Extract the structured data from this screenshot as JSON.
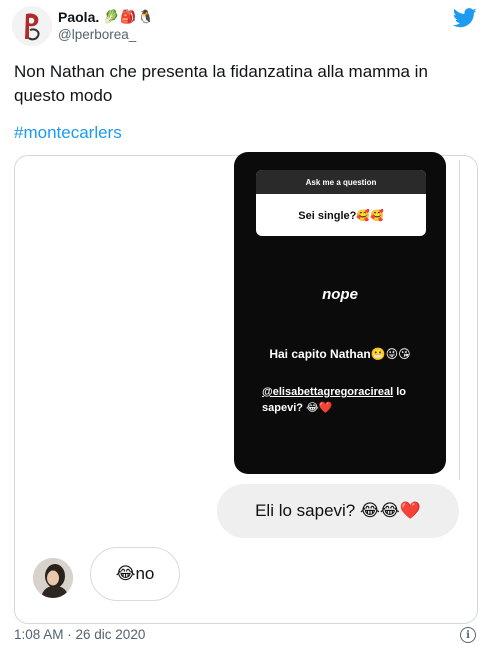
{
  "author": {
    "name": "Paola.",
    "name_emojis": "🥬🎒🐧",
    "handle": "@lperborea_"
  },
  "tweet": {
    "text": "Non Nathan che presenta la fidanzatina alla mamma in questo modo",
    "hashtag": "#montecarlers"
  },
  "story": {
    "question_title": "Ask me a question",
    "question_answer": "Sei single?🥰🥰",
    "answer_word": "nope",
    "caption_line": "Hai capito Nathan😬😜😘",
    "mention_handle": "@elisabettagregoracireal",
    "mention_rest": " lo sapevi? 😂❤️"
  },
  "chat": {
    "sent_text": "Eli lo sapevi? 😂😂❤️",
    "reply_text": "😂no"
  },
  "footer": {
    "timestamp": "1:08 AM · 26 dic 2020",
    "info_glyph": "i"
  },
  "colors": {
    "accent": "#1d9bf0",
    "text": "#0f1419",
    "muted": "#536471",
    "story_bg": "#0b0b0b",
    "bubble_bg": "#efefef"
  },
  "icons": [
    "profile-avatar-icon",
    "twitter-bird-icon",
    "info-icon"
  ]
}
